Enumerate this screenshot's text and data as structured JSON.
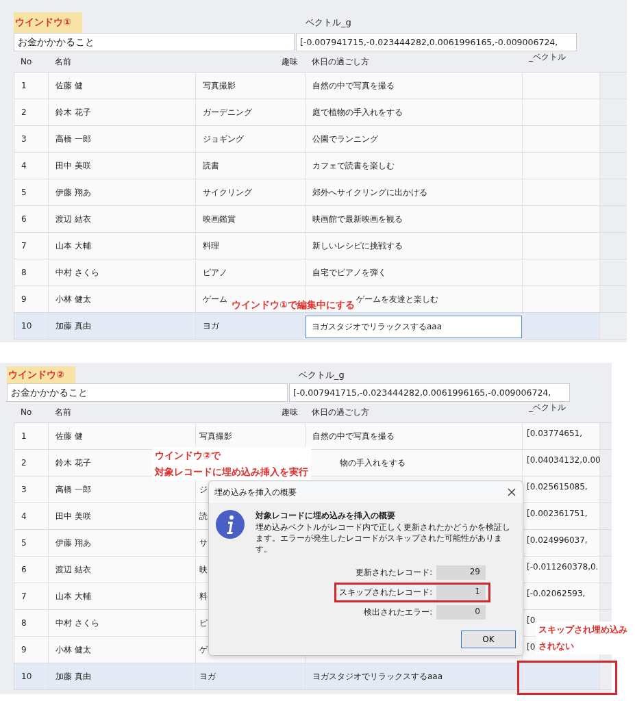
{
  "windows": [
    {
      "label": "ウインドウ①",
      "vector_label": "ベクトル_g",
      "query": "お金かかかること",
      "vector_value": "[-0.007941715,-0.023444282,0.0061996165,-0.009006724,",
      "columns": [
        "No",
        "名前",
        "趣味",
        "休日の過ごし方",
        "_ベクトル"
      ],
      "rows": [
        {
          "no": "1",
          "name": "佐藤 健",
          "hobby": "写真撮影",
          "activity": "自然の中で写真を撮る",
          "vector": "",
          "selected": false,
          "editing": false,
          "flagged": false
        },
        {
          "no": "2",
          "name": "鈴木 花子",
          "hobby": "ガーデニング",
          "activity": "庭で植物の手入れをする",
          "vector": "",
          "selected": false,
          "editing": false,
          "flagged": false
        },
        {
          "no": "3",
          "name": "高橋 一郎",
          "hobby": "ジョギング",
          "activity": "公園でランニング",
          "vector": "",
          "selected": false,
          "editing": false,
          "flagged": false
        },
        {
          "no": "4",
          "name": "田中 美咲",
          "hobby": "読書",
          "activity": "カフェで読書を楽しむ",
          "vector": "",
          "selected": false,
          "editing": false,
          "flagged": false
        },
        {
          "no": "5",
          "name": "伊藤 翔あ",
          "hobby": "サイクリング",
          "activity": "郊外へサイクリングに出かける",
          "vector": "",
          "selected": false,
          "editing": false,
          "flagged": false
        },
        {
          "no": "6",
          "name": "渡辺 結衣",
          "hobby": "映画鑑賞",
          "activity": "映画館で最新映画を観る",
          "vector": "",
          "selected": false,
          "editing": false,
          "flagged": false
        },
        {
          "no": "7",
          "name": "山本 大輔",
          "hobby": "料理",
          "activity": "新しいレシピに挑戦する",
          "vector": "",
          "selected": false,
          "editing": false,
          "flagged": false
        },
        {
          "no": "8",
          "name": "中村 さくら",
          "hobby": "ピアノ",
          "activity": "自宅でピアノを弾く",
          "vector": "",
          "selected": false,
          "editing": false,
          "flagged": false
        },
        {
          "no": "9",
          "name": "小林 健太",
          "hobby": "ゲーム",
          "activity": "ゲームを友達と楽しむ",
          "vector": "",
          "selected": false,
          "editing": false,
          "flagged": false
        },
        {
          "no": "10",
          "name": "加藤 真由",
          "hobby": "ヨガ",
          "activity": "ヨガスタジオでリラックスするaaa",
          "vector": "",
          "selected": true,
          "editing": true,
          "flagged": false
        }
      ],
      "annotations": [
        {
          "lines": [
            "ウインドウ①で編集中にする"
          ]
        }
      ]
    },
    {
      "label": "ウインドウ②",
      "vector_label": "ベクトル_g",
      "query": "お金かかかること",
      "vector_value": "[-0.007941715,-0.023444282,0.0061996165,-0.009006724,",
      "columns": [
        "No",
        "名前",
        "趣味",
        "休日の過ごし方",
        "_ベクトル"
      ],
      "rows": [
        {
          "no": "1",
          "name": "佐藤 健",
          "hobby": "写真撮影",
          "activity": "自然の中で写真を撮る",
          "vector": "[0.03774651,",
          "selected": false,
          "editing": false,
          "flagged": false
        },
        {
          "no": "2",
          "name": "鈴木 花子",
          "hobby": "",
          "activity": "物の手入れをする",
          "vector": "[0.04034132,0.00",
          "selected": false,
          "editing": false,
          "flagged": false
        },
        {
          "no": "3",
          "name": "高橋 一郎",
          "hobby": "ジ",
          "activity": "",
          "vector": "[0.025615085,",
          "selected": false,
          "editing": false,
          "flagged": false
        },
        {
          "no": "4",
          "name": "田中 美咲",
          "hobby": "読",
          "activity": "",
          "vector": "[0.002361751,",
          "selected": false,
          "editing": false,
          "flagged": false
        },
        {
          "no": "5",
          "name": "伊藤 翔あ",
          "hobby": "サ",
          "activity": "",
          "vector": "[0.024996037,",
          "selected": false,
          "editing": false,
          "flagged": false
        },
        {
          "no": "6",
          "name": "渡辺 結衣",
          "hobby": "映",
          "activity": "",
          "vector": "[-0.011260378,0.",
          "selected": false,
          "editing": false,
          "flagged": false
        },
        {
          "no": "7",
          "name": "山本 大輔",
          "hobby": "料",
          "activity": "",
          "vector": "[-0.02062593,",
          "selected": false,
          "editing": false,
          "flagged": false
        },
        {
          "no": "8",
          "name": "中村 さくら",
          "hobby": "ピ",
          "activity": "",
          "vector": "[0",
          "selected": false,
          "editing": false,
          "flagged": false
        },
        {
          "no": "9",
          "name": "小林 健太",
          "hobby": "ゲ",
          "activity": "",
          "vector": "[0",
          "selected": false,
          "editing": false,
          "flagged": false
        },
        {
          "no": "10",
          "name": "加藤 真由",
          "hobby": "ヨガ",
          "activity": "ヨガスタジオでリラックスするaaa",
          "vector": "",
          "selected": true,
          "editing": false,
          "flagged": true
        }
      ],
      "annotations": [
        {
          "lines": [
            "ウインドウ②で",
            "対象レコードに埋め込み挿入を実行"
          ]
        },
        {
          "lines": [
            "スキップされ埋め込み",
            "されない"
          ]
        }
      ],
      "dialog": {
        "title": "埋め込みを挿入の概要",
        "heading": "対象レコードに埋め込みを挿入の概要",
        "message": "埋め込みベクトルがレコード内で正しく更新されたかどうかを検証します。エラーが発生したレコードがスキップされた可能性があります。",
        "stats": [
          {
            "label": "更新されたレコード:",
            "value": "29",
            "highlighted": false
          },
          {
            "label": "スキップされたレコード:",
            "value": "1",
            "highlighted": true
          },
          {
            "label": "検出されたエラー:",
            "value": "0",
            "highlighted": false
          }
        ],
        "button": "OK"
      }
    }
  ]
}
